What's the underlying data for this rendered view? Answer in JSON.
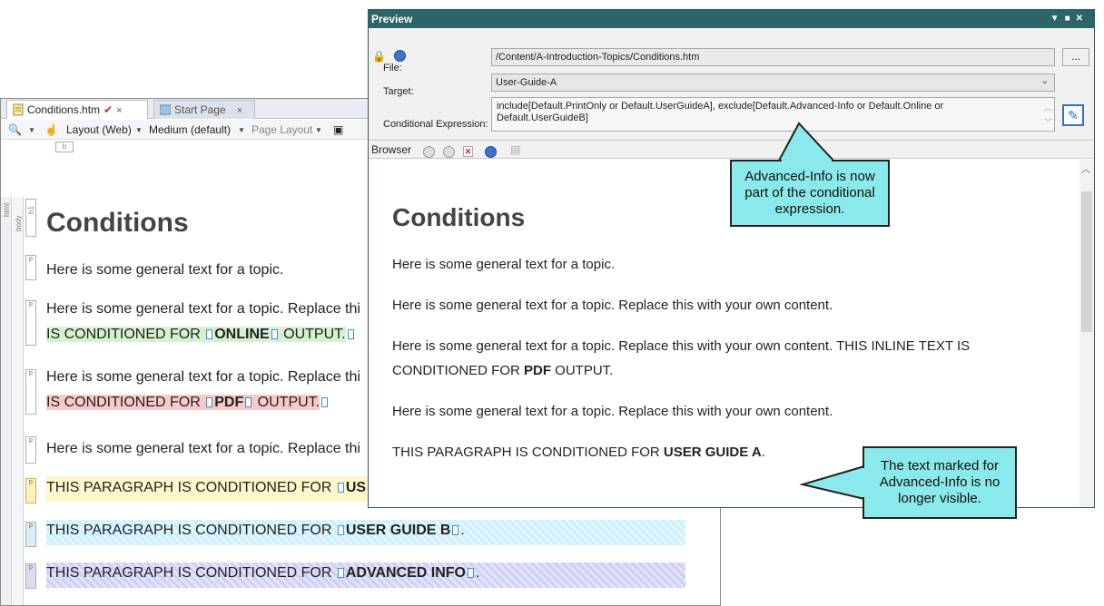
{
  "editor": {
    "tabs": [
      {
        "label": "Conditions.htm",
        "close": "×"
      },
      {
        "label": "Start Page",
        "close": "×"
      }
    ],
    "toolbar": {
      "layout": "Layout (Web)",
      "medium": "Medium (default)",
      "page_layout": "Page Layout"
    },
    "struct_labels": [
      "html",
      "body",
      "h1",
      "b"
    ],
    "pmark": "p",
    "heading": "Conditions",
    "p1": "Here is some general text for a topic.",
    "p2a": "Here is some general text for a topic. Replace thi",
    "p2b_pre": "IS CONDITIONED FOR ",
    "p2b_cond": "ONLINE",
    "p2b_post": " OUTPUT.",
    "p3a": "Here is some general text for a topic. Replace thi",
    "p3b_pre": "IS CONDITIONED FOR ",
    "p3b_cond": "PDF",
    "p3b_post": " OUTPUT.",
    "p4": "Here is some general text for a topic. Replace thi",
    "p5_pre": "THIS PARAGRAPH IS CONDITIONED FOR ",
    "p5_cond": "US",
    "p6_pre": "THIS PARAGRAPH IS CONDITIONED FOR ",
    "p6_cond": "USER GUIDE B",
    "p6_post": ".",
    "p7_pre": "THIS PARAGRAPH IS CONDITIONED FOR ",
    "p7_cond": "ADVANCED INFO",
    "p7_post": "."
  },
  "preview": {
    "title": "Preview",
    "file_label": "File:",
    "file_value": "/Content/A-Introduction-Topics/Conditions.htm",
    "file_button": "...",
    "target_label": "Target:",
    "target_value": "User-Guide-A",
    "expr_label": "Conditional Expression:",
    "expr_line1": "include[Default.PrintOnly or Default.UserGuideA], exclude[Default.Advanced-Info or Default.Online or",
    "expr_line2": "Default.UserGuideB]",
    "browser_label": "Browser",
    "heading": "Conditions",
    "p1": "Here is some general text for a topic.",
    "p2": "Here is some general text for a topic. Replace this with your own content.",
    "p3a": "Here is some general text for a topic. Replace this with your own content. THIS INLINE TEXT IS",
    "p3b_pre": "CONDITIONED FOR ",
    "p3b_cond": "PDF",
    "p3b_post": " OUTPUT.",
    "p4": "Here is some general text for a topic. Replace this with your own content.",
    "p5_pre": "THIS PARAGRAPH IS CONDITIONED FOR ",
    "p5_cond": "USER GUIDE A",
    "p5_post": "."
  },
  "callouts": {
    "top": [
      "Advanced-Info is now",
      "part of the conditional",
      "expression."
    ],
    "bottom": [
      "The text marked for",
      "Advanced-Info is no",
      "longer visible."
    ]
  },
  "colors": {
    "callout_fill": "#8ae9ea",
    "preview_titlebar": "#2d6468",
    "online_highlight": "#d7f0d2",
    "pdf_highlight": "#f8c9c9",
    "userguide_a_band": "#fdf7c9",
    "userguide_b_band": "#cdeefb",
    "advanced_info_band": "#cfcff4"
  }
}
